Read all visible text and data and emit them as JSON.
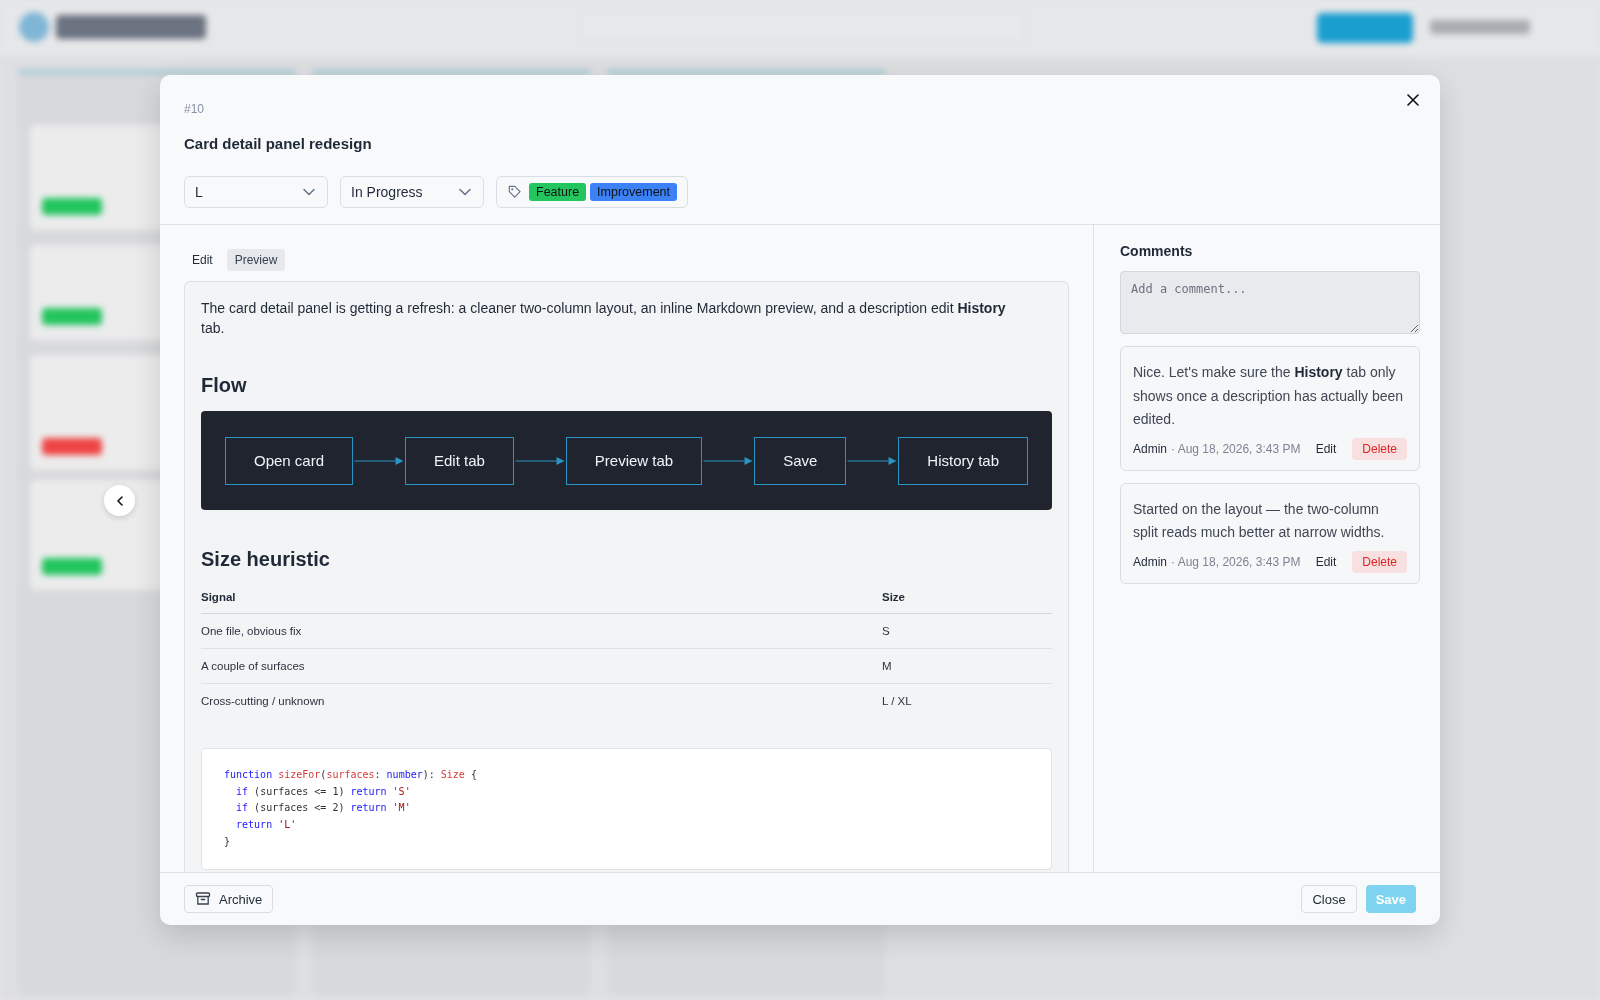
{
  "card": {
    "number": "#10",
    "title": "Card detail panel redesign",
    "size": "L",
    "status": "In Progress",
    "tags": [
      {
        "label": "Feature",
        "color": "#22c55e"
      },
      {
        "label": "Improvement",
        "color": "#3b82f6"
      }
    ]
  },
  "editor_tabs": [
    {
      "label": "Edit",
      "selected": false
    },
    {
      "label": "Preview",
      "selected": true
    }
  ],
  "preview": {
    "intro": "The card detail panel is getting a refresh: a cleaner two-column layout, an inline Markdown preview, and a description edit **History** tab.",
    "flow_heading": "Flow",
    "flow_nodes": [
      "Open card",
      "Edit tab",
      "Preview tab",
      "Save",
      "History tab"
    ],
    "table_heading": "Size heuristic",
    "table": {
      "columns": [
        "Signal",
        "Size"
      ],
      "rows": [
        [
          "One file, obvious fix",
          "S"
        ],
        [
          "A couple of surfaces",
          "M"
        ],
        [
          "Cross-cutting / unknown",
          "L / XL"
        ]
      ]
    },
    "code": [
      [
        {
          "kind": "keyword",
          "text": "function"
        },
        {
          "kind": "ident",
          "text": " sizeFor"
        },
        {
          "kind": "plain",
          "text": "("
        },
        {
          "kind": "ident",
          "text": "surfaces"
        },
        {
          "kind": "plain",
          "text": ": "
        },
        {
          "kind": "keyword",
          "text": "number"
        },
        {
          "kind": "plain",
          "text": "): "
        },
        {
          "kind": "ident",
          "text": "Size"
        },
        {
          "kind": "plain",
          "text": " {"
        }
      ],
      [
        {
          "kind": "keyword",
          "text": "  if"
        },
        {
          "kind": "plain",
          "text": " (surfaces <= 1) "
        },
        {
          "kind": "keyword",
          "text": "return"
        },
        {
          "kind": "string",
          "text": " 'S'"
        }
      ],
      [
        {
          "kind": "keyword",
          "text": "  if"
        },
        {
          "kind": "plain",
          "text": " (surfaces <= 2) "
        },
        {
          "kind": "keyword",
          "text": "return"
        },
        {
          "kind": "string",
          "text": " 'M'"
        }
      ],
      [
        {
          "kind": "keyword",
          "text": "  return"
        },
        {
          "kind": "string",
          "text": " 'L'"
        }
      ],
      [
        {
          "kind": "plain",
          "text": "}"
        }
      ]
    ]
  },
  "comments": {
    "title": "Comments",
    "placeholder": "Add a comment...",
    "items": [
      {
        "text": "Nice. Let's make sure the **History** tab only shows once a description has actually been edited.",
        "author": "Admin",
        "meta": "· Aug 18, 2026, 3:43 PM",
        "edit": "Edit",
        "delete": "Delete"
      },
      {
        "text": "Started on the layout — the two-column split reads much better at narrow widths.",
        "author": "Admin",
        "meta": "· Aug 18, 2026, 3:43 PM",
        "edit": "Edit",
        "delete": "Delete"
      }
    ]
  },
  "footer": {
    "archive": "Archive",
    "close": "Close",
    "save": {
      "label": "Save",
      "disabled": true
    }
  }
}
